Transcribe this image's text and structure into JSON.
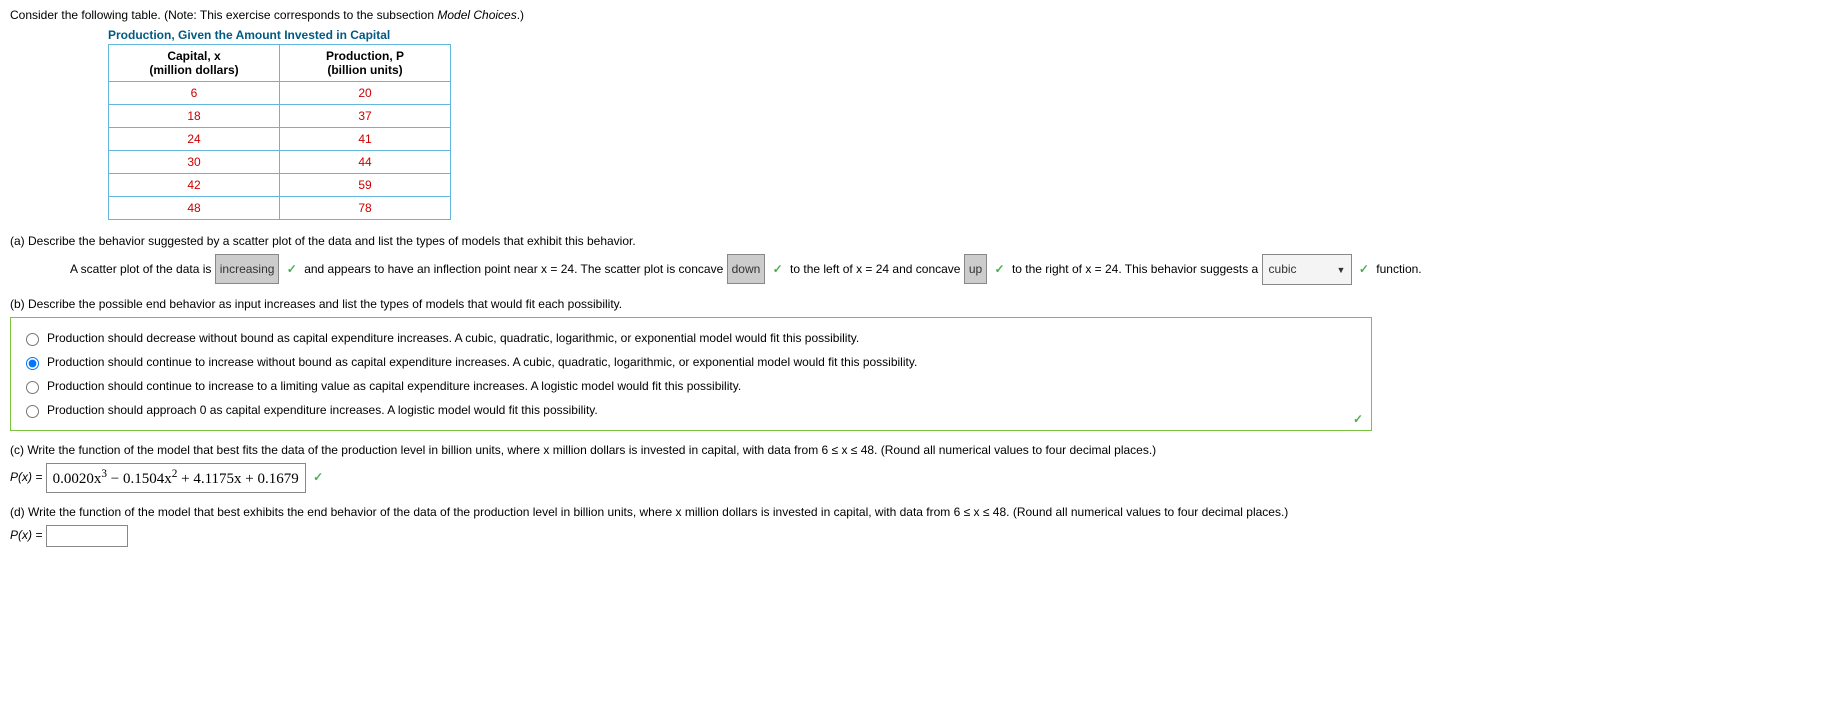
{
  "intro": {
    "text_before": "Consider the following table. (Note: This exercise corresponds to the subsection ",
    "italic": "Model Choices",
    "text_after": ".)"
  },
  "table": {
    "title": "Production, Given the Amount Invested in Capital",
    "col1_line1": "Capital, x",
    "col1_line2": "(million dollars)",
    "col2_line1": "Production, P",
    "col2_line2": "(billion units)",
    "rows": [
      {
        "c": "6",
        "p": "20"
      },
      {
        "c": "18",
        "p": "37"
      },
      {
        "c": "24",
        "p": "41"
      },
      {
        "c": "30",
        "p": "44"
      },
      {
        "c": "42",
        "p": "59"
      },
      {
        "c": "48",
        "p": "78"
      }
    ]
  },
  "partA": {
    "prompt": "(a) Describe the behavior suggested by a scatter plot of the data and list the types of models that exhibit this behavior.",
    "t0": "A scatter plot of the data is ",
    "ans0": "increasing",
    "t1": " and appears to have an inflection point near x = 24. The scatter plot is concave ",
    "ans1": "down",
    "t2": " to the left of x = 24 and concave ",
    "ans2": "up",
    "t3": " to the right of x = 24. This behavior suggests a ",
    "ans3": "cubic",
    "t4": " function."
  },
  "partB": {
    "prompt": "(b) Describe the possible end behavior as input increases and list the types of models that would fit each possibility.",
    "options": [
      "Production should decrease without bound as capital expenditure increases. A cubic, quadratic, logarithmic, or exponential model would fit this possibility.",
      "Production should continue to increase without bound as capital expenditure increases. A cubic, quadratic, logarithmic, or exponential model would fit this possibility.",
      "Production should continue to increase to a limiting value as capital expenditure increases. A logistic model would fit this possibility.",
      "Production should approach 0 as capital expenditure increases. A logistic model would fit this possibility."
    ],
    "selected": 1
  },
  "partC": {
    "prompt": "(c) Write the function of the model that best fits the data of the production level in billion units, where x million dollars is invested in capital, with data from  6 ≤ x ≤ 48.  (Round all numerical values to four decimal places.)",
    "lhs": "P(x) = ",
    "answer_html": "0.0020x<sup>3</sup> − 0.1504x<sup>2</sup> + 4.1175x + 0.1679"
  },
  "partD": {
    "prompt": "(d) Write the function of the model that best exhibits the end behavior of the data of the production level in billion units, where x million dollars is invested in capital, with data from  6 ≤ x ≤ 48.  (Round all numerical values to four decimal places.)",
    "lhs": "P(x) = "
  },
  "icons": {
    "check": "✓",
    "caret": "▼"
  }
}
